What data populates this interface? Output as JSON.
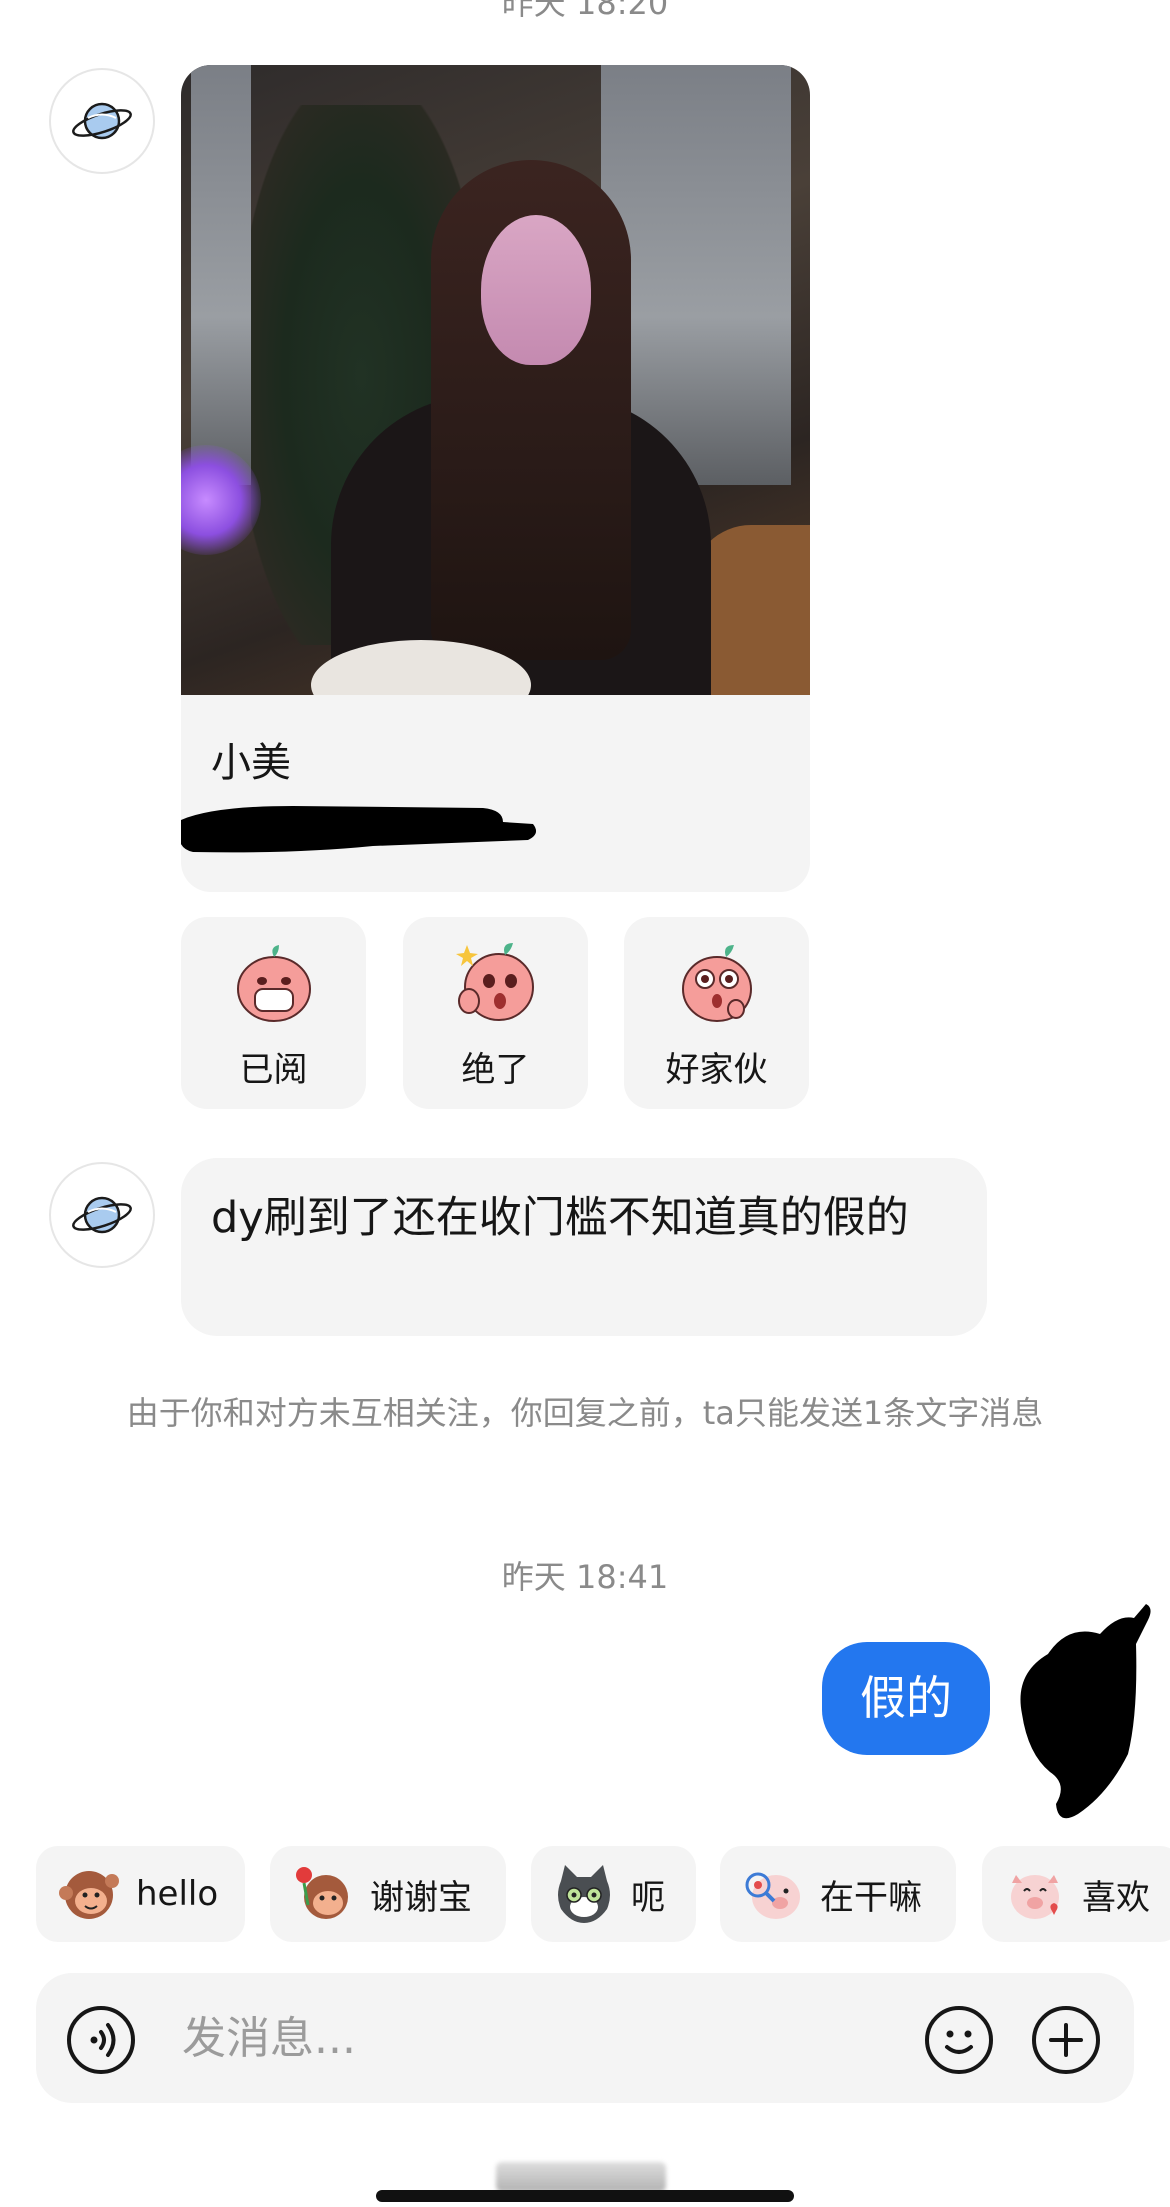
{
  "timestamps": {
    "top": "昨天 18:20",
    "middle": "昨天 18:41"
  },
  "profile_card": {
    "name": "小美"
  },
  "reactions": [
    {
      "label": "已阅",
      "icon": "peach-mask-sticker-icon"
    },
    {
      "label": "绝了",
      "icon": "peach-thumbs-up-sticker-icon"
    },
    {
      "label": "好家伙",
      "icon": "peach-shocked-sticker-icon"
    }
  ],
  "incoming_message": {
    "text": "dy刷到了还在收门槛不知道真的假的"
  },
  "system_note": "由于你和对方未互相关注，你回复之前，ta只能发送1条文字消息",
  "outgoing_message": {
    "text": "假的"
  },
  "quick_replies": [
    {
      "label": "hello",
      "icon": "monkey-wave-sticker-icon"
    },
    {
      "label": "谢谢宝",
      "icon": "monkey-rose-sticker-icon"
    },
    {
      "label": "呃",
      "icon": "cat-sticker-icon"
    },
    {
      "label": "在干嘛",
      "icon": "pig-magnifier-sticker-icon"
    },
    {
      "label": "喜欢",
      "icon": "pig-love-sticker-icon"
    }
  ],
  "composer": {
    "placeholder": "发消息..."
  },
  "colors": {
    "accent": "#2377ef",
    "bubble_bg": "#f4f4f4",
    "muted_text": "#8a8a8a"
  }
}
